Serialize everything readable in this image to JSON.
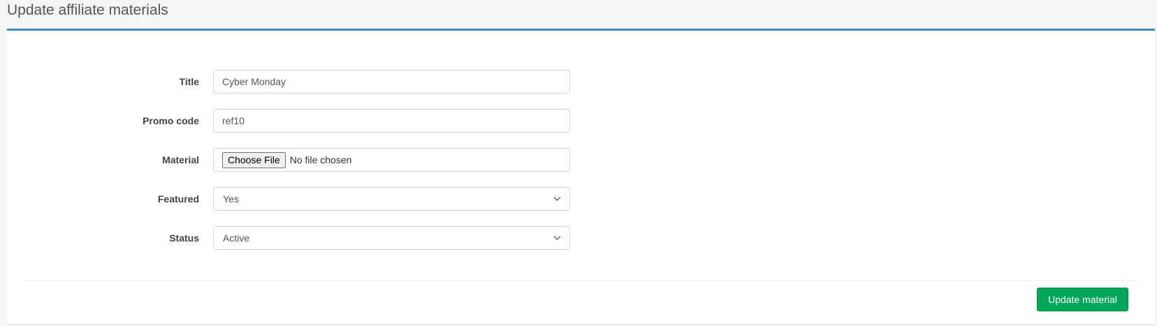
{
  "page": {
    "title": "Update affiliate materials"
  },
  "form": {
    "title": {
      "label": "Title",
      "value": "Cyber Monday"
    },
    "promo_code": {
      "label": "Promo code",
      "value": "ref10"
    },
    "material": {
      "label": "Material",
      "button_label": "Choose File",
      "status_text": "No file chosen"
    },
    "featured": {
      "label": "Featured",
      "selected": "Yes"
    },
    "status": {
      "label": "Status",
      "selected": "Active"
    }
  },
  "actions": {
    "submit_label": "Update material"
  },
  "colors": {
    "accent_border": "#3c8dbc",
    "submit_bg": "#00a65a"
  },
  "icons": {
    "select_arrow": "chevron-down-icon"
  }
}
